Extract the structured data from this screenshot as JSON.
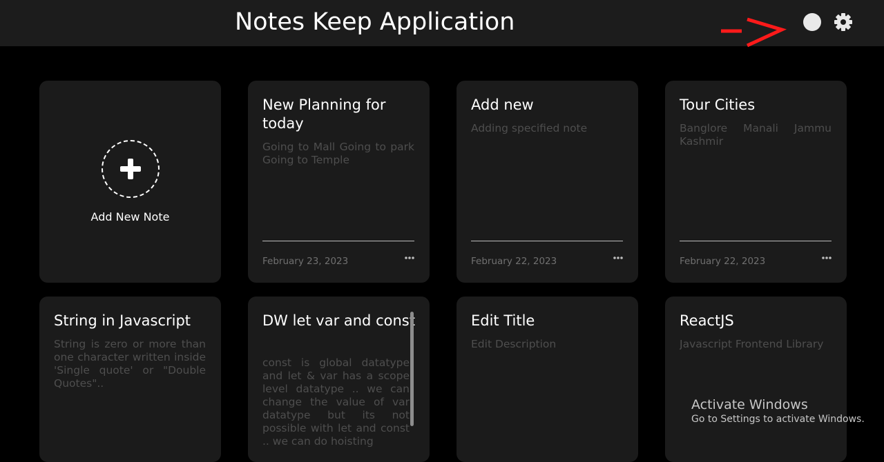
{
  "header": {
    "title": "Notes Keep Application",
    "annotation_color": "#ff1a1a",
    "theme_toggle_icon": "circle-toggle-icon",
    "settings_icon": "gear-icon"
  },
  "add_note": {
    "label": "Add New Note",
    "icon": "plus-icon"
  },
  "notes": [
    {
      "title": "New Planning for today",
      "description": "Going to Mall Going to park Going to Temple",
      "date": "February 23, 2023"
    },
    {
      "title": "Add new",
      "description": "Adding specified note",
      "date": "February 22, 2023"
    },
    {
      "title": "Tour Cities",
      "description": "Banglore Manali Jammu Kashmir",
      "date": "February 22, 2023"
    },
    {
      "title": "String in Javascript",
      "description": "String is zero or more than one character written inside 'Single quote' or \"Double Quotes\".."
    },
    {
      "title": "DW let var and const",
      "description": "const is global datatype and let & var has a scope level datatype .. we can change the value of var datatype but its not possible with let and const .. we can do hoisting"
    },
    {
      "title": "Edit Title",
      "description": "Edit Description"
    },
    {
      "title": "ReactJS",
      "description": "Javascript Frontend Library"
    }
  ],
  "watermark": {
    "title": "Activate Windows",
    "subtitle": "Go to Settings to activate Windows."
  }
}
